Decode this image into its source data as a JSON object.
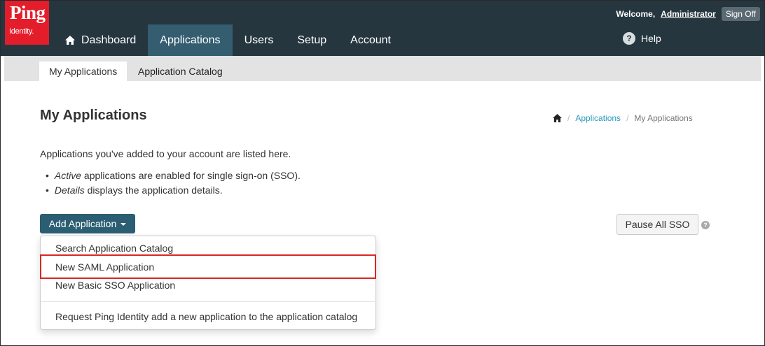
{
  "brand": {
    "logo_word": "Ping",
    "logo_sub": "Identity."
  },
  "account": {
    "welcome": "Welcome,",
    "user": "Administrator",
    "sign_off": "Sign Off"
  },
  "nav": {
    "items": [
      {
        "label": "Dashboard",
        "icon": "home-icon",
        "active": false
      },
      {
        "label": "Applications",
        "active": true
      },
      {
        "label": "Users",
        "active": false
      },
      {
        "label": "Setup",
        "active": false
      },
      {
        "label": "Account",
        "active": false
      }
    ],
    "help_label": "Help",
    "help_icon": "?"
  },
  "subnav": {
    "tabs": [
      {
        "label": "My Applications",
        "active": true
      },
      {
        "label": "Application Catalog",
        "active": false
      }
    ]
  },
  "page": {
    "title": "My Applications",
    "breadcrumb": {
      "home_icon": "home-icon",
      "items": [
        "Applications",
        "My Applications"
      ]
    },
    "intro": "Applications you've added to your account are listed here.",
    "bullets": [
      {
        "em": "Active",
        "rest": " applications are enabled for single sign-on (SSO)."
      },
      {
        "em": "Details",
        "rest": " displays the application details."
      }
    ]
  },
  "actions": {
    "add_application": "Add Application",
    "pause_all_sso": "Pause All SSO",
    "pause_help_icon": "?"
  },
  "dropdown": {
    "items": [
      "Search Application Catalog",
      "New SAML Application",
      "New Basic SSO Application",
      "Request Ping Identity add a new application to the application catalog"
    ],
    "highlighted_index": 1
  },
  "colors": {
    "header": "#25363f",
    "active_nav": "#345d70",
    "logo": "#e41d2b",
    "primary_button": "#2b5e73",
    "link": "#2a9abf",
    "highlight_border": "#d7281f"
  }
}
